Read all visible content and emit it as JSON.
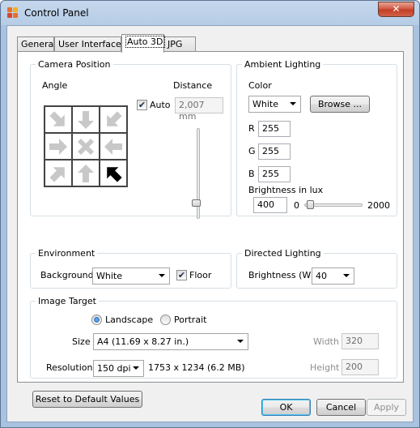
{
  "window": {
    "title": "Control Panel",
    "close_glyph": "✕"
  },
  "tabs": [
    {
      "label": "General"
    },
    {
      "label": "User Interface"
    },
    {
      "label": "Auto 3D"
    },
    {
      "label": "JPG"
    }
  ],
  "camera": {
    "legend": "Camera Position",
    "angle_label": "Angle",
    "distance_label": "Distance",
    "auto_label": "Auto",
    "auto_checked": true,
    "distance_value": "2,007 mm",
    "selected_direction": "bottom-right",
    "directions": [
      "top-left",
      "top",
      "top-right",
      "left",
      "center",
      "right",
      "bottom-left",
      "bottom",
      "bottom-right"
    ]
  },
  "ambient": {
    "legend": "Ambient Lighting",
    "color_label": "Color",
    "color_value": "White",
    "browse_label": "Browse ...",
    "r_label": "R",
    "r_value": "255",
    "g_label": "G",
    "g_value": "255",
    "b_label": "B",
    "b_value": "255",
    "brightness_label": "Brightness in lux",
    "brightness_value": "400",
    "slider_min": "0",
    "slider_max": "2000",
    "slider_level": 0.1
  },
  "environment": {
    "legend": "Environment",
    "background_label": "Background",
    "background_value": "White",
    "floor_label": "Floor",
    "floor_checked": true
  },
  "directed": {
    "legend": "Directed Lighting",
    "brightness_label": "Brightness (W)",
    "brightness_value": "40"
  },
  "target": {
    "legend": "Image Target",
    "landscape_label": "Landscape",
    "portrait_label": "Portrait",
    "size_label": "Size",
    "size_value": "A4 (11.69 x 8.27 in.)",
    "width_label": "Width",
    "width_value": "320",
    "resolution_label": "Resolution",
    "resolution_value": "150 dpi",
    "resolution_info": "1753 x 1234 (6.2 MB)",
    "height_label": "Height",
    "height_value": "200"
  },
  "reset_label": "Reset to Default Values",
  "footer": {
    "ok_label": "OK",
    "cancel_label": "Cancel",
    "apply_label": "Apply"
  },
  "colors": {
    "arrow_inactive": "#c8c8c8",
    "arrow_active": "#000000",
    "accent": "#3c7fb1"
  }
}
